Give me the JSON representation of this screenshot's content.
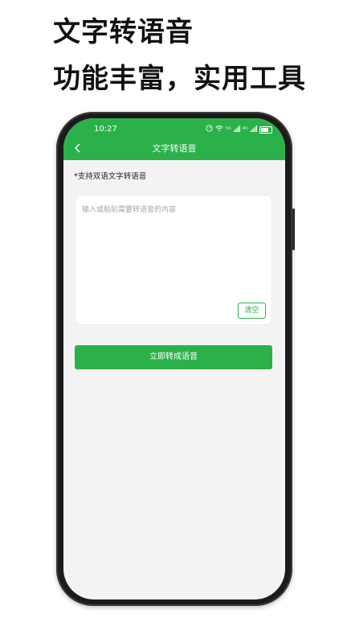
{
  "promo": {
    "headline": "文字转语音",
    "subline": "功能丰富，实用工具"
  },
  "status_bar": {
    "time": "10:27",
    "signal_labels": [
      "⁵ᴳ",
      "⁴ᴳ"
    ]
  },
  "app_bar": {
    "title": "文字转语音"
  },
  "content": {
    "hint": "*支持双语文字转语音",
    "input_placeholder": "输入或粘贴需要转语音的内容",
    "input_value": "",
    "clear_label": "清空",
    "convert_label": "立即转成语音"
  },
  "colors": {
    "brand_green": "#2bb14a",
    "screen_background": "#f3f3f3"
  }
}
